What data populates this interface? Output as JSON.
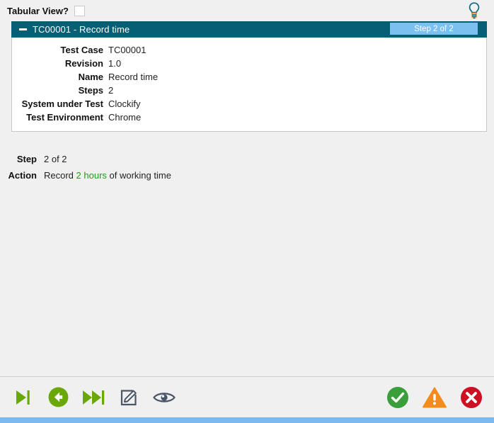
{
  "topbar": {
    "tabular_view_label": "Tabular View?",
    "tabular_view_checked": false,
    "hint_icon": "lightbulb-icon"
  },
  "panel": {
    "collapse_icon": "minus-icon",
    "title": "TC00001 - Record time",
    "step_badge": "Step 2 of 2",
    "header_color": "#065f74",
    "badge_color": "#7cc0ef",
    "fields": [
      {
        "label": "Test Case",
        "value": "TC00001"
      },
      {
        "label": "Revision",
        "value": "1.0"
      },
      {
        "label": "Name",
        "value": "Record time"
      },
      {
        "label": "Steps",
        "value": "2"
      },
      {
        "label": "System under Test",
        "value": "Clockify"
      },
      {
        "label": "Test Environment",
        "value": "Chrome"
      }
    ]
  },
  "step_block": {
    "step_label": "Step",
    "step_value": "2 of 2",
    "action_label": "Action",
    "action_prefix": "Record ",
    "action_param": "2 hours",
    "action_suffix": " of working time",
    "param_color": "#1c9e1c"
  },
  "toolbar": {
    "left": [
      {
        "name": "step-to-end-button",
        "icon": "step-forward-icon",
        "color": "#6aa80a"
      },
      {
        "name": "previous-step-button",
        "icon": "back-circle-icon",
        "color": "#6aa80a"
      },
      {
        "name": "next-step-button",
        "icon": "fast-forward-icon",
        "color": "#6aa80a"
      },
      {
        "name": "edit-button",
        "icon": "edit-pencil-icon",
        "color": "#4a5568"
      },
      {
        "name": "view-button",
        "icon": "eye-icon",
        "color": "#4a5568"
      }
    ],
    "right": [
      {
        "name": "pass-button",
        "icon": "check-circle-icon",
        "color": "#3a9e3a"
      },
      {
        "name": "warning-button",
        "icon": "warning-triangle-icon",
        "color": "#f28c1e"
      },
      {
        "name": "fail-button",
        "icon": "close-circle-icon",
        "color": "#cc1122"
      }
    ]
  },
  "bottom_strip_color": "#7db9ef"
}
